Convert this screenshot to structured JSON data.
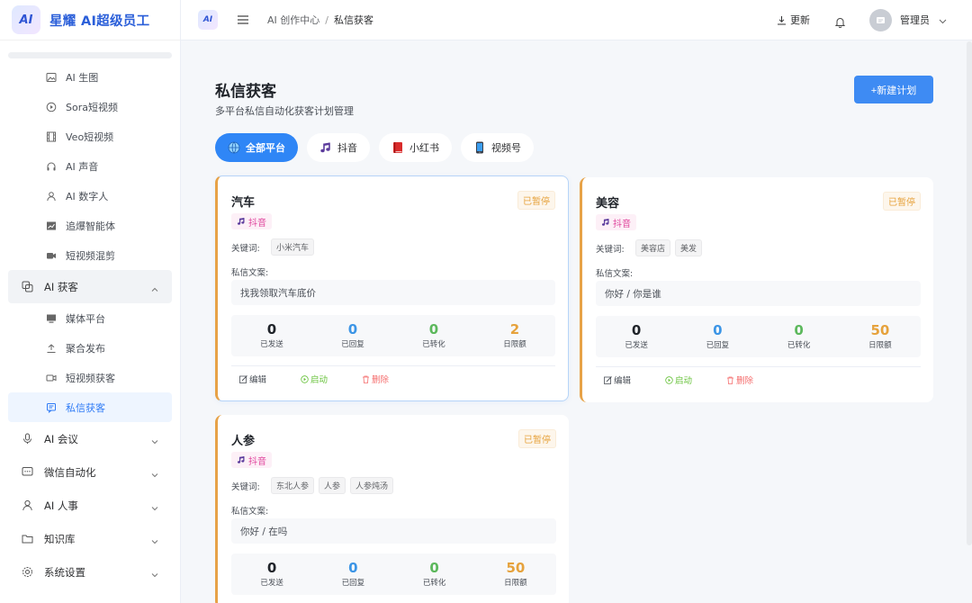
{
  "brand": {
    "logo_text": "AI",
    "name": "星耀 AI超级员工"
  },
  "sidebar": {
    "sub_items_top": [
      {
        "label": "AI 生图",
        "icon": "image-icon"
      },
      {
        "label": "Sora短视频",
        "icon": "play-circle-icon"
      },
      {
        "label": "Veo短视频",
        "icon": "film-icon"
      },
      {
        "label": "AI 声音",
        "icon": "headphones-icon"
      },
      {
        "label": "AI 数字人",
        "icon": "user-icon"
      },
      {
        "label": "追爆智能体",
        "icon": "chart-icon"
      },
      {
        "label": "短视频混剪",
        "icon": "video-cut-icon"
      }
    ],
    "group_acquire": {
      "label": "AI 获客",
      "icon": "layers-icon"
    },
    "sub_items_acquire": [
      {
        "label": "媒体平台",
        "icon": "monitor-icon"
      },
      {
        "label": "聚合发布",
        "icon": "upload-icon"
      },
      {
        "label": "短视频获客",
        "icon": "camera-icon"
      },
      {
        "label": "私信获客",
        "icon": "message-icon"
      }
    ],
    "groups": [
      {
        "label": "AI 会议",
        "icon": "microphone-icon"
      },
      {
        "label": "微信自动化",
        "icon": "chat-icon"
      },
      {
        "label": "AI 人事",
        "icon": "person-icon"
      },
      {
        "label": "知识库",
        "icon": "folder-icon"
      },
      {
        "label": "系统设置",
        "icon": "gear-icon"
      }
    ]
  },
  "topbar": {
    "logo_text": "AI",
    "breadcrumb": [
      "AI 创作中心",
      "私信获客"
    ],
    "breadcrumb_sep": "/",
    "update_label": "更新",
    "user_name": "管理员"
  },
  "page": {
    "title": "私信获客",
    "subtitle": "多平台私信自动化获客计划管理",
    "new_button": "+新建计划"
  },
  "tabs": [
    {
      "label": "全部平台",
      "icon": "globe-icon",
      "active": true
    },
    {
      "label": "抖音",
      "icon": "tiktok-icon",
      "active": false
    },
    {
      "label": "小红书",
      "icon": "red-book-icon",
      "active": false
    },
    {
      "label": "视频号",
      "icon": "phone-icon",
      "active": false
    }
  ],
  "card_labels": {
    "keywords": "关键词:",
    "message": "私信文案:",
    "stat_sent": "已发送",
    "stat_replied": "已回复",
    "stat_converted": "已转化",
    "stat_daily": "日限额",
    "edit": "编辑",
    "start": "启动",
    "delete": "删除"
  },
  "colors": {
    "accent": "#2f86f6",
    "sent": "#1f2329",
    "replied": "#3c95e6",
    "converted": "#5cb85c",
    "daily": "#e6a23c"
  },
  "cards": [
    {
      "title": "汽车",
      "status": "已暂停",
      "platform": "抖音",
      "keywords": [
        "小米汽车"
      ],
      "message": "找我领取汽车底价",
      "sent": "0",
      "replied": "0",
      "converted": "0",
      "daily": "2"
    },
    {
      "title": "美容",
      "status": "已暂停",
      "platform": "抖音",
      "keywords": [
        "美容店",
        "美发"
      ],
      "message": "你好 / 你是谁",
      "sent": "0",
      "replied": "0",
      "converted": "0",
      "daily": "50"
    },
    {
      "title": "人参",
      "status": "已暂停",
      "platform": "抖音",
      "keywords": [
        "东北人参",
        "人参",
        "人参炖汤"
      ],
      "message": "你好 / 在吗",
      "sent": "0",
      "replied": "0",
      "converted": "0",
      "daily": "50"
    }
  ]
}
